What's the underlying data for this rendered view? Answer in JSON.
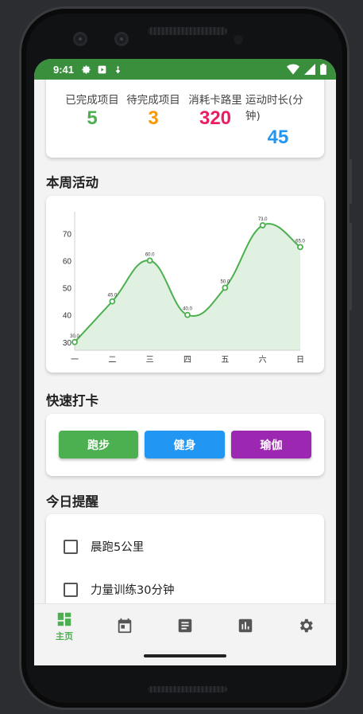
{
  "status_bar": {
    "time": "9:41"
  },
  "stats": [
    {
      "label": "已完成项目",
      "value": "5",
      "color": "#4caf50"
    },
    {
      "label": "待完成项目",
      "value": "3",
      "color": "#ff9800"
    },
    {
      "label": "消耗卡路里",
      "value": "320",
      "color": "#e91e63"
    },
    {
      "label": "运动时长(分钟)",
      "value": "45",
      "color": "#2196f3"
    }
  ],
  "sections": {
    "weekly": "本周活动",
    "quick": "快速打卡",
    "reminders": "今日提醒"
  },
  "chart_data": {
    "type": "area",
    "categories": [
      "一",
      "二",
      "三",
      "四",
      "五",
      "六",
      "日"
    ],
    "values": [
      30,
      45,
      60,
      40,
      50,
      73,
      65
    ],
    "value_labels": [
      "30.0",
      "45.0",
      "60.0",
      "40.0",
      "50.0",
      "73.0",
      "65.0"
    ],
    "y_ticks": [
      30,
      40,
      50,
      60,
      70
    ],
    "ylim": [
      27,
      78
    ],
    "color": "#4caf50",
    "fill": "#e0f1e1",
    "grid": false
  },
  "quick_buttons": [
    {
      "label": "跑步",
      "color": "#4caf50"
    },
    {
      "label": "健身",
      "color": "#2196f3"
    },
    {
      "label": "瑜伽",
      "color": "#9c27b0"
    }
  ],
  "reminders": [
    {
      "text": "晨跑5公里",
      "checked": false
    },
    {
      "text": "力量训练30分钟",
      "checked": false
    }
  ],
  "bottom_nav": {
    "home_label": "主页",
    "items": [
      "dashboard-icon",
      "calendar-icon",
      "article-icon",
      "bar-chart-icon",
      "gear-icon"
    ],
    "active_color": "#4caf50"
  }
}
